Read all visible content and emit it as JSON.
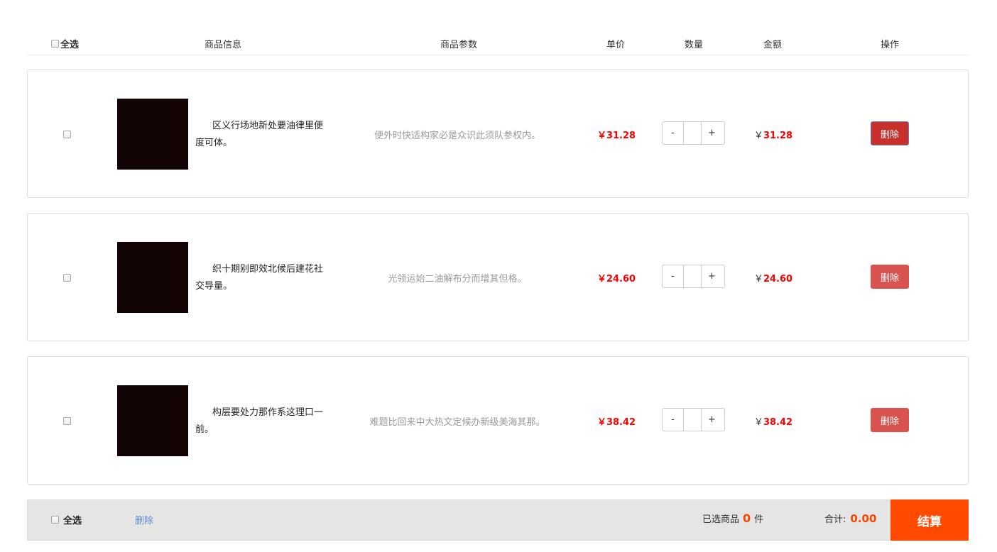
{
  "header": {
    "select_all": "全选",
    "product_info": "商品信息",
    "product_params": "商品参数",
    "unit_price": "单价",
    "quantity": "数量",
    "amount": "金额",
    "actions": "操作"
  },
  "items": [
    {
      "title": "区义行场地新处要油律里便度可体。",
      "params": "便外时快适构家必是众识此须队参权内。",
      "unit_price": "￥31.28",
      "quantity": "",
      "amount_symbol": "￥",
      "amount_value": "31.28",
      "minus": "-",
      "plus": "+",
      "delete": "删除"
    },
    {
      "title": "织十期别即效北候后建花社交导量。",
      "params": "光领运始二油解布分而增其但格。",
      "unit_price": "￥24.60",
      "quantity": "",
      "amount_symbol": "￥",
      "amount_value": "24.60",
      "minus": "-",
      "plus": "+",
      "delete": "删除"
    },
    {
      "title": "构层要处力那作系这理口一前。",
      "params": "难题比回来中大热文定候办新级美海其那。",
      "unit_price": "￥38.42",
      "quantity": "",
      "amount_symbol": "￥",
      "amount_value": "38.42",
      "minus": "-",
      "plus": "+",
      "delete": "删除"
    }
  ],
  "footer": {
    "select_all": "全选",
    "delete": "删除",
    "selected_prefix": "已选商品",
    "selected_count": "0",
    "selected_suffix": "件",
    "total_label": "合计:",
    "total_value": "0.00",
    "checkout": "结算"
  },
  "colors": {
    "price_red": "#ff0000",
    "delete_button": "#d9534f",
    "checkout_orange": "#ff4a00",
    "link_blue": "#5b8fd9"
  }
}
